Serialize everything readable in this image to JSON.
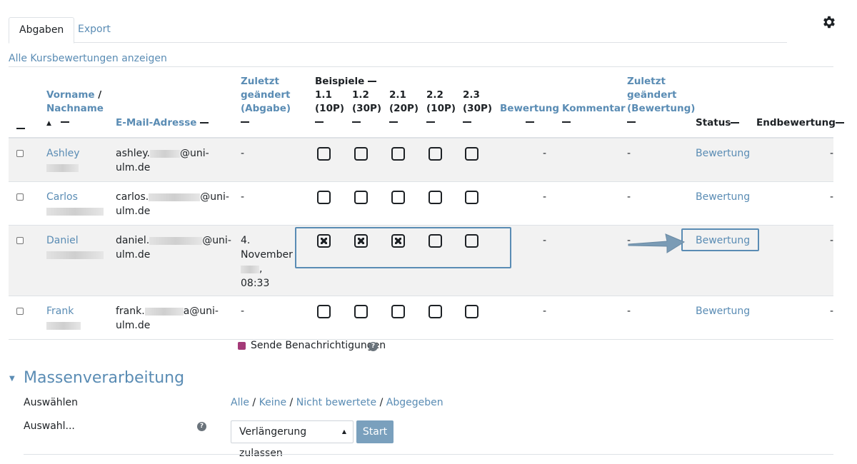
{
  "tabs": [
    "Abgaben",
    "Export"
  ],
  "all_grades_link": "Alle Kursbewertungen anzeigen",
  "columns": {
    "name_line1": "Vorname",
    "name_sep": "/",
    "name_line2": "Nachname",
    "email": "E-Mail-Adresse",
    "modified_sub": [
      "Zuletzt",
      "geändert",
      "(Abgabe)"
    ],
    "beispiele": "Beispiele",
    "examples": [
      {
        "num": "1.1",
        "pts": "(10P)"
      },
      {
        "num": "1.2",
        "pts": "(30P)"
      },
      {
        "num": "2.1",
        "pts": "(20P)"
      },
      {
        "num": "2.2",
        "pts": "(10P)"
      },
      {
        "num": "2.3",
        "pts": "(30P)"
      }
    ],
    "grade": "Bewertung",
    "comment": "Kommentar",
    "modified_grade": [
      "Zuletzt",
      "geändert",
      "(Bewertung)"
    ],
    "status": "Status",
    "final": "Endbewertung"
  },
  "rows": [
    {
      "first": "Ashley",
      "email_pre": "ashley.",
      "email_post": "@uni-",
      "email_line2": "ulm.de",
      "modified": [
        "-"
      ],
      "checks": [
        false,
        false,
        false,
        false,
        false
      ],
      "grade": "-",
      "modified_grade": "-",
      "status": "Bewertung",
      "final": "-"
    },
    {
      "first": "Carlos",
      "email_pre": "carlos.",
      "email_post": "@uni-",
      "email_line2": "ulm.de",
      "modified": [
        "-"
      ],
      "checks": [
        false,
        false,
        false,
        false,
        false
      ],
      "grade": "-",
      "modified_grade": "-",
      "status": "Bewertung",
      "final": "-"
    },
    {
      "first": "Daniel",
      "email_pre": "daniel.",
      "email_post": "@uni-",
      "email_line2": "ulm.de",
      "modified": [
        "4.",
        "November",
        ",",
        "08:33"
      ],
      "checks": [
        true,
        true,
        true,
        false,
        false
      ],
      "grade": "-",
      "modified_grade": "-",
      "status": "Bewertung",
      "final": "-"
    },
    {
      "first": "Frank",
      "email_pre": "frank.",
      "email_post": "a@uni-",
      "email_line2": "ulm.de",
      "modified": [
        "-"
      ],
      "checks": [
        false,
        false,
        false,
        false,
        false
      ],
      "grade": "-",
      "modified_grade": "-",
      "status": "Bewertung",
      "final": "-"
    }
  ],
  "notify_label": "Sende Benachrichtigungen",
  "bulk": {
    "heading": "Massenverarbeitung",
    "select_label": "Auswählen",
    "select_links": [
      "Alle",
      "Keine",
      "Nicht bewertete",
      "Abgegeben"
    ],
    "action_label": "Auswahl...",
    "action_value": "Verlängerung zulassen",
    "start": "Start"
  },
  "colors": {
    "link": "#5a8cb4",
    "highlight": "#5a8cb4",
    "row_alt": "#f2f2f2"
  }
}
